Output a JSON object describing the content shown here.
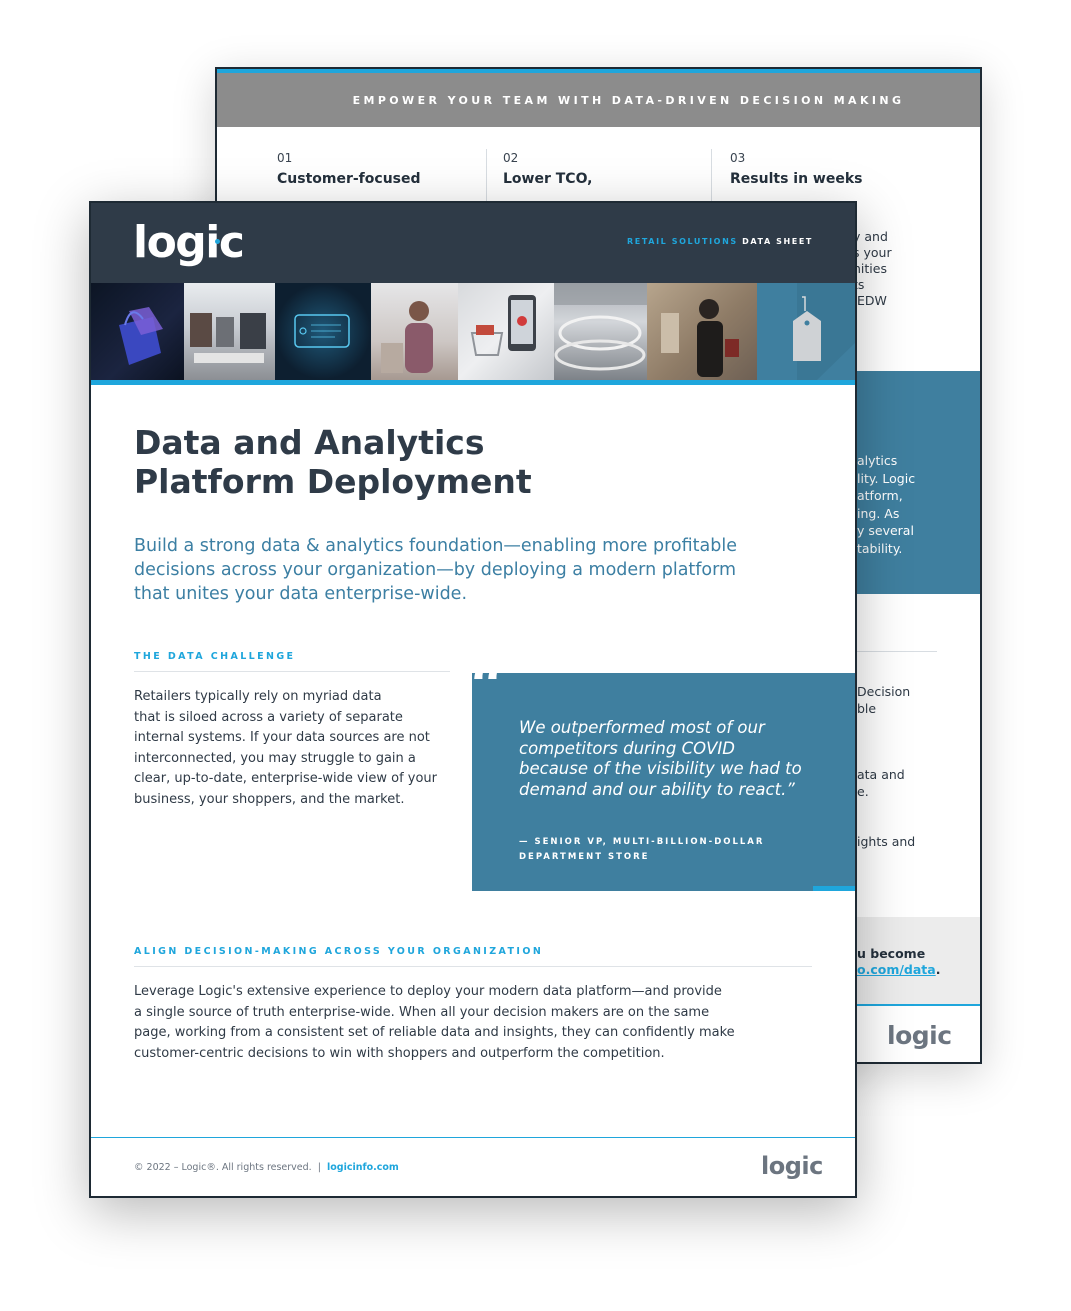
{
  "back_page": {
    "banner": "EMPOWER YOUR TEAM WITH DATA-DRIVEN DECISION MAKING",
    "columns": [
      {
        "num": "01",
        "title": "Customer-focused"
      },
      {
        "num": "02",
        "title": "Lower TCO,"
      },
      {
        "num": "03",
        "title": "Results in weeks"
      }
    ],
    "col3_fragments": [
      "y and",
      "s your",
      "nities",
      "ts",
      " EDW"
    ],
    "blue_panel_fragments": [
      "alytics",
      "lity. Logic",
      "atform,",
      "ing. As",
      "y several",
      "tability."
    ],
    "lower_fragments": [
      "Decision",
      "ble",
      "ata and",
      "e.",
      "ights and"
    ],
    "cta_line1": "u become",
    "cta_link": "o.com/data",
    "cta_period": ".",
    "logo": "logic"
  },
  "front_page": {
    "logo": "logic",
    "tag_highlight": "RETAIL SOLUTIONS",
    "tag_rest": "DATA SHEET",
    "title_lines": [
      "Data and Analytics",
      "Platform Deployment"
    ],
    "subtitle_lines": [
      "Build a strong data & analytics foundation—enabling more profitable",
      "decisions across your organization—by deploying a modern platform",
      "that unites your data enterprise-wide."
    ],
    "section1_label": "THE DATA CHALLENGE",
    "section1_lines": [
      "Retailers typically rely on myriad data",
      "that is siloed across a variety of separate",
      "internal systems. If your data sources are not",
      "interconnected, you may struggle to gain a",
      "clear, up-to-date, enterprise-wide view of your",
      "business, your shoppers, and the market."
    ],
    "quote_mark": "“",
    "quote_lines": [
      "We outperformed most of our",
      "competitors during COVID",
      "because of the visibility we had to",
      "demand and our ability to react.”"
    ],
    "quote_attr_lines": [
      "— SENIOR VP, MULTI-BILLION-DOLLAR",
      "DEPARTMENT STORE"
    ],
    "section2_label": "ALIGN DECISION-MAKING ACROSS YOUR ORGANIZATION",
    "section2_lines": [
      "Leverage Logic's extensive experience to deploy your modern data platform—and provide",
      "a single source of truth enterprise-wide. When all your decision makers are on the same",
      "page, working from a consistent set of reliable data and insights, they can confidently make",
      "customer-centric decisions to win with shoppers and outperform the competition."
    ],
    "footer_copyright": "© 2022 – Logic®. All rights reserved.  |  ",
    "footer_link": "logicinfo.com",
    "footer_logo": "logic"
  },
  "colors": {
    "header_dark": "#2f3b48",
    "accent_blue": "#1fa6dc",
    "panel_blue": "#3f7f9f",
    "banner_gray": "#8c8c8c"
  }
}
